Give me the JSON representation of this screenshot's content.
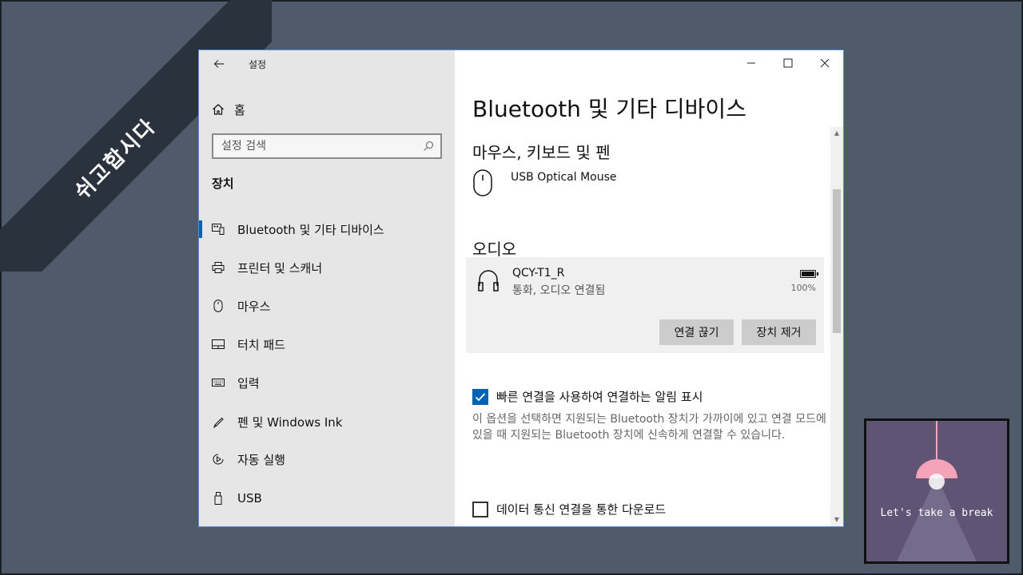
{
  "overlay": {
    "ribbon_text": "쉬고합시다",
    "break_text": "Let's take a break"
  },
  "window": {
    "title": "설정",
    "back_icon": "arrow-left-icon",
    "controls": [
      "minimize-icon",
      "maximize-icon",
      "close-icon"
    ]
  },
  "sidebar": {
    "home_label": "홈",
    "search_placeholder": "설정 검색",
    "section_heading": "장치",
    "items": [
      {
        "label": "Bluetooth 및 기타 디바이스",
        "icon": "bluetooth-devices-icon",
        "active": true
      },
      {
        "label": "프린터 및 스캐너",
        "icon": "printer-icon",
        "active": false
      },
      {
        "label": "마우스",
        "icon": "mouse-icon",
        "active": false
      },
      {
        "label": "터치 패드",
        "icon": "touchpad-icon",
        "active": false
      },
      {
        "label": "입력",
        "icon": "keyboard-icon",
        "active": false
      },
      {
        "label": "펜 및 Windows Ink",
        "icon": "pen-icon",
        "active": false
      },
      {
        "label": "자동 실행",
        "icon": "autoplay-icon",
        "active": false
      },
      {
        "label": "USB",
        "icon": "usb-icon",
        "active": false
      }
    ]
  },
  "main": {
    "title": "Bluetooth 및 기타 디바이스",
    "mouse_group": {
      "heading": "마우스, 키보드 및 펜",
      "device_name": "USB Optical Mouse"
    },
    "audio_group": {
      "heading": "오디오",
      "device_name": "QCY-T1_R",
      "device_status": "통화, 오디오 연결됨",
      "battery_percent": "100%",
      "battery_level": 1.0,
      "disconnect_label": "연결 끊기",
      "remove_label": "장치 제거"
    },
    "swift_pair": {
      "label": "빠른 연결을 사용하여 연결하는 알림 표시",
      "checked": true,
      "description": "이 옵션을 선택하면 지원되는 Bluetooth 장치가 가까이에 있고 연결 모드에 있을 때 지원되는 Bluetooth 장치에 신속하게 연결할 수 있습니다."
    },
    "metered": {
      "label": "데이터 통신 연결을 통한 다운로드",
      "checked": false
    }
  },
  "colors": {
    "accent": "#0063b1",
    "sidebar_bg": "#e6e6e6",
    "desktop_bg": "#4f5b6b",
    "lamp_pink": "#f4a3b8",
    "break_bg": "#5f5474"
  }
}
